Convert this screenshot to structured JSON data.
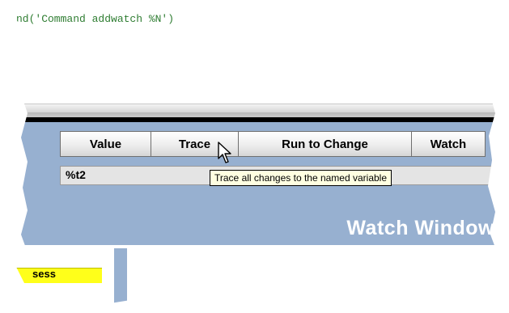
{
  "editor": {
    "code_line": "nd('Command addwatch %N')"
  },
  "toolbar": {
    "buttons": [
      {
        "label": "Value"
      },
      {
        "label": "Trace"
      },
      {
        "label": "Run to Change"
      },
      {
        "label": "Watch"
      }
    ]
  },
  "variable_input": {
    "value": "%t2"
  },
  "tooltip": {
    "text": "Trace all changes to the named variable"
  },
  "panel": {
    "title": "Watch Window"
  },
  "sidebar": {
    "session_label": "sess"
  },
  "colors": {
    "panel_blue": "#97b0d0",
    "code_green": "#2f7d32",
    "tooltip_bg": "#ffffe1",
    "highlight_yellow": "#ffff1a"
  }
}
